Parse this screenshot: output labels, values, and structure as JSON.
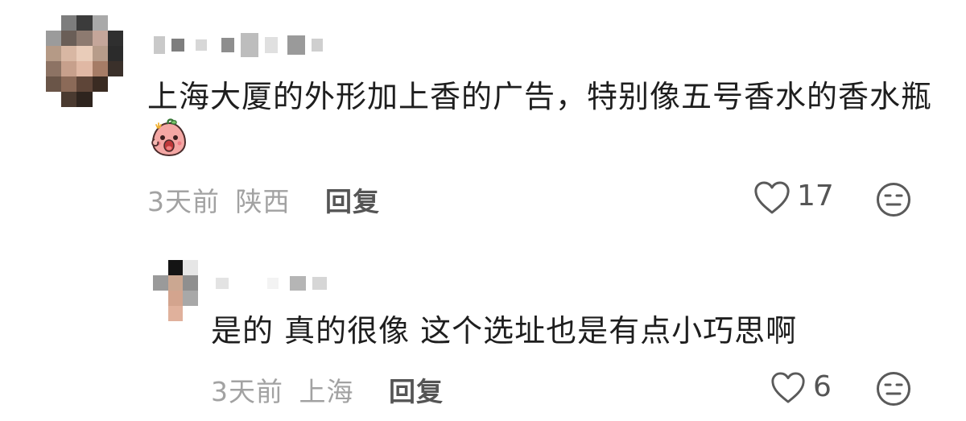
{
  "comments": [
    {
      "text": "上海大厦的外形加上香的广告，特别像五号香水的香水瓶",
      "time": "3天前",
      "location": "陕西",
      "reply_label": "回复",
      "likes": "17",
      "emoji": "shouting-peach-sticker"
    },
    {
      "text": "是的 真的很像 这个选址也是有点小巧思啊",
      "time": "3天前",
      "location": "上海",
      "reply_label": "回复",
      "likes": "6"
    }
  ],
  "icons": {
    "like": "heart-outline-icon",
    "dislike": "neutral-face-icon"
  },
  "colors": {
    "text": "#1e1e1e",
    "meta": "#a2a2a2",
    "action": "#555555"
  }
}
